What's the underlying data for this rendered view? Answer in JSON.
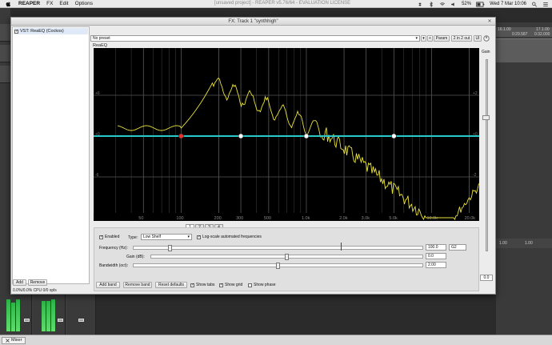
{
  "menubar": {
    "app": "REAPER",
    "items": [
      "FX",
      "Edit",
      "Options"
    ],
    "window_title": "[unsaved project] - REAPER v5.76/64 - EVALUATION LICENSE",
    "battery": "52%",
    "clock": "Wed 7 Mar 10:06"
  },
  "background": {
    "ruler_a": "16.1.00",
    "ruler_b": "17.1.00",
    "ruler_c": "0:29.587",
    "ruler_d": "0:32.000",
    "status_a": "1.00",
    "status_b": "1.00",
    "mixer_tab": "Mixer"
  },
  "fx_window": {
    "title": "FX: Track 1 \"synthhigh\"",
    "fx_item": "VST: ReaEQ (Cockos)",
    "add_label": "Add",
    "remove_label": "Remove",
    "cpu": "0.0%/0.0% CPU 0/0 spls",
    "preset": "No preset",
    "plus_label": "+",
    "param_label": "Param",
    "io_label": "2 in 2 out",
    "ui_label": "UI",
    "plugin_name": "ReaEQ",
    "gain_label": "Gain",
    "gain_value": "0.0"
  },
  "graph": {
    "db_labels": [
      "+6",
      "+0",
      "-6"
    ],
    "right_db_labels": [
      "+2",
      "+0",
      "-2"
    ],
    "freq_labels": [
      "50",
      "100",
      "200",
      "300",
      "500",
      "1.0k",
      "2.0k",
      "3.0k",
      "5.0k",
      "10.0k",
      "20.0k"
    ],
    "freq_values": [
      50,
      100,
      200,
      300,
      500,
      1000,
      2000,
      3000,
      5000,
      10000,
      20000
    ],
    "band_colors": {
      "active": "#e8322e",
      "inactive": "#ffffff",
      "eq_line": "#29c9c9",
      "spectrum": "#e9e23a",
      "grid": "#3a3a3a"
    }
  },
  "bands": {
    "tabs": [
      "1",
      "2",
      "3",
      "4"
    ],
    "active_tab": "1",
    "enabled_label": "Enabled",
    "type_label": "Type:",
    "type_value": "Low Shelf",
    "log_label": "Log-scale automated frequencies",
    "frequency_label": "Frequency (Hz):",
    "frequency_value": "100.0",
    "frequency_note": "G2",
    "gain_label": "Gain (dB):",
    "gain_value": "0.0",
    "bandwidth_label": "Bandwidth (oct):",
    "bandwidth_value": "2.00",
    "frequency_slider": 0.12,
    "gain_slider": 0.5,
    "bandwidth_slider": 0.5
  },
  "bottom": {
    "add_band": "Add band",
    "remove_band": "Remove band",
    "reset_defaults": "Reset defaults",
    "show_tabs": "Show tabs",
    "show_grid": "Show grid",
    "show_phase": "Show phase"
  }
}
